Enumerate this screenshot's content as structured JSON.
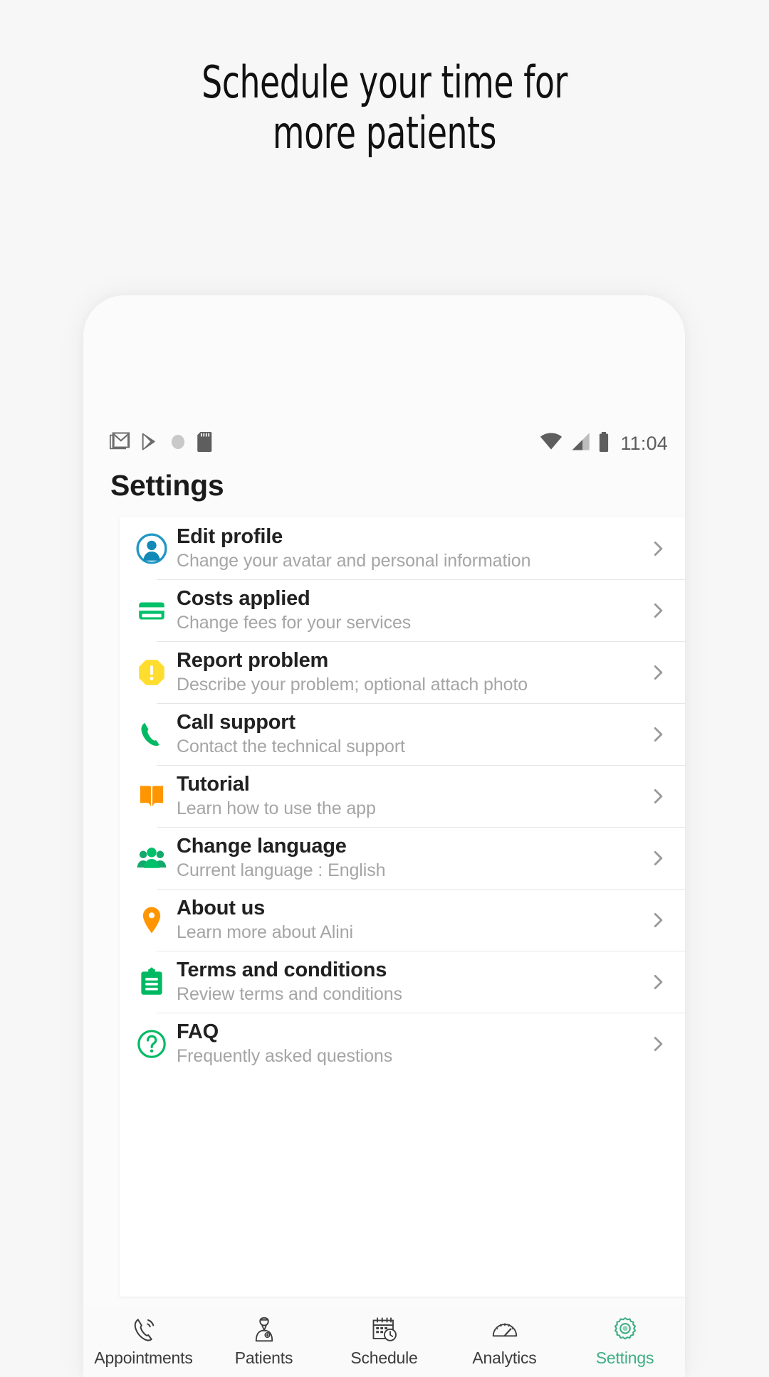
{
  "promo": {
    "headline_line1": "Schedule your time for",
    "headline_line2": "more patients"
  },
  "colors": {
    "page_background": "#f7f7f7",
    "accent_green": "#3fae84",
    "icon_blue": "#0e8ab5",
    "icon_green": "#00c06a",
    "icon_yellow": "#ffdd2e",
    "icon_orange": "#ff9500",
    "title_text": "#212121",
    "subtitle_text": "#a5a5a5"
  },
  "status_bar": {
    "time": "11:04",
    "left_icons": [
      "gmail-icon",
      "play-store-icon",
      "circle-icon",
      "sd-card-icon"
    ],
    "right_icons": [
      "wifi-icon",
      "cellular-signal-icon",
      "battery-icon"
    ]
  },
  "app_bar": {
    "title": "Settings"
  },
  "settings_list": {
    "items": [
      {
        "icon": "avatar-icon",
        "title": "Edit profile",
        "subtitle": "Change your avatar and personal information"
      },
      {
        "icon": "credit-card-icon",
        "title": "Costs applied",
        "subtitle": "Change fees for your services"
      },
      {
        "icon": "warning-icon",
        "title": "Report problem",
        "subtitle": "Describe your problem; optional attach photo"
      },
      {
        "icon": "phone-icon",
        "title": "Call support",
        "subtitle": "Contact the technical support"
      },
      {
        "icon": "book-icon",
        "title": "Tutorial",
        "subtitle": "Learn how to use the app"
      },
      {
        "icon": "people-icon",
        "title": "Change language",
        "subtitle": "Current language : English"
      },
      {
        "icon": "map-pin-icon",
        "title": "About us",
        "subtitle": "Learn more about Alini"
      },
      {
        "icon": "clipboard-icon",
        "title": "Terms and conditions",
        "subtitle": "Review terms and conditions"
      },
      {
        "icon": "question-circle-icon",
        "title": "FAQ",
        "subtitle": "Frequently asked questions"
      }
    ]
  },
  "bottom_nav": {
    "items": [
      {
        "icon": "ringing-phone-icon",
        "label": "Appointments",
        "active": false
      },
      {
        "icon": "doctor-icon",
        "label": "Patients",
        "active": false
      },
      {
        "icon": "calendar-clock-icon",
        "label": "Schedule",
        "active": false
      },
      {
        "icon": "gauge-icon",
        "label": "Analytics",
        "active": false
      },
      {
        "icon": "gear-icon",
        "label": "Settings",
        "active": true
      }
    ]
  }
}
